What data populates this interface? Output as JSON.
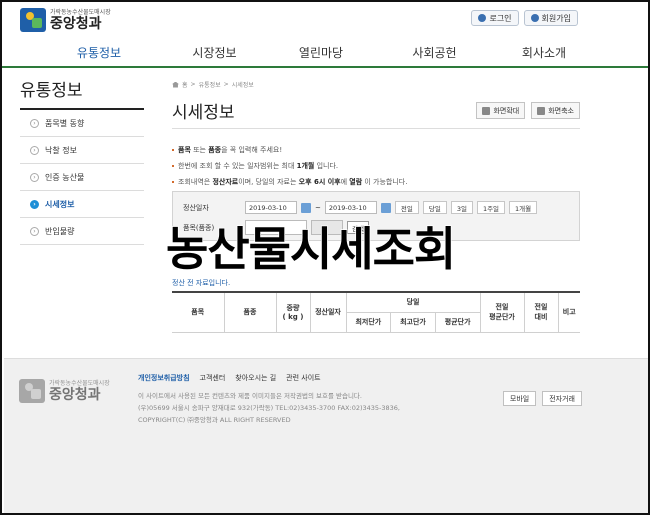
{
  "header": {
    "logo_sub": "가락동농수산물도매시장",
    "logo_name": "중앙청과",
    "login": "로그인",
    "signup": "회원가입"
  },
  "nav": [
    "유통정보",
    "시장정보",
    "열린마당",
    "사회공헌",
    "회사소개"
  ],
  "sidebar": {
    "title": "유통정보",
    "items": [
      {
        "label": "품목별 동향"
      },
      {
        "label": "낙찰 정보"
      },
      {
        "label": "인증 농산물"
      },
      {
        "label": "시세정보"
      },
      {
        "label": "반입물량"
      }
    ]
  },
  "breadcrumb": [
    "홈",
    ">",
    "유통정보",
    ">",
    "시세정보"
  ],
  "page": {
    "title": "시세정보",
    "zoom_in": "화면확대",
    "zoom_out": "화면축소"
  },
  "notes": {
    "n1_a": "품목",
    "n1_b": " 또는 ",
    "n1_c": "품종",
    "n1_d": "을 꼭 입력해 주세요!",
    "n2_a": "한번에 조회 할 수 있는 일자범위는 최대 ",
    "n2_b": "1개월",
    "n2_c": " 입니다.",
    "n3_a": "조회내역은 ",
    "n3_b": "정산자료",
    "n3_c": "이며, 당일의 자료는 ",
    "n3_d": "오후 6시 이후",
    "n3_e": "에 ",
    "n3_f": "열람",
    "n3_g": " 이 가능합니다."
  },
  "search": {
    "date_label": "정산일자",
    "from": "2019-03-10",
    "sep": "~",
    "to": "2019-03-10",
    "ranges": [
      "전일",
      "당일",
      "3일",
      "1주일",
      "1개월"
    ],
    "item_label": "품목(품종)",
    "search_btn": "검색"
  },
  "overlay_text": "농산물시세조회",
  "partial_text": "정산 전 자료입니다.",
  "table": {
    "item": "품목",
    "variety": "품종",
    "weight": "중량",
    "weight_unit": "( kg )",
    "settle_date": "정산일자",
    "today": "당일",
    "min": "최저단가",
    "max": "최고단가",
    "avg": "평균단가",
    "prev_avg_1": "전일",
    "prev_avg_2": "평균단가",
    "prev_cmp_1": "전일",
    "prev_cmp_2": "대비",
    "note": "비고"
  },
  "footer": {
    "links": [
      "개인정보취급방침",
      "고객센터",
      "찾아오시는 길",
      "관련 사이트"
    ],
    "line1": "이 사이트에서 사용된 모든 컨텐츠와 제품 이미지들은 저작권법의 보호를 받습니다.",
    "line2": "(우)05699 서울시 송파구 양재대로 932(가락동) TEL:02)3435-3700 FAX:02)3435-3836,",
    "line3": "COPYRIGHT(C) ㈜중앙청과 ALL RIGHT RESERVED",
    "mobile": "모바일",
    "e_auction": "전자거래"
  }
}
